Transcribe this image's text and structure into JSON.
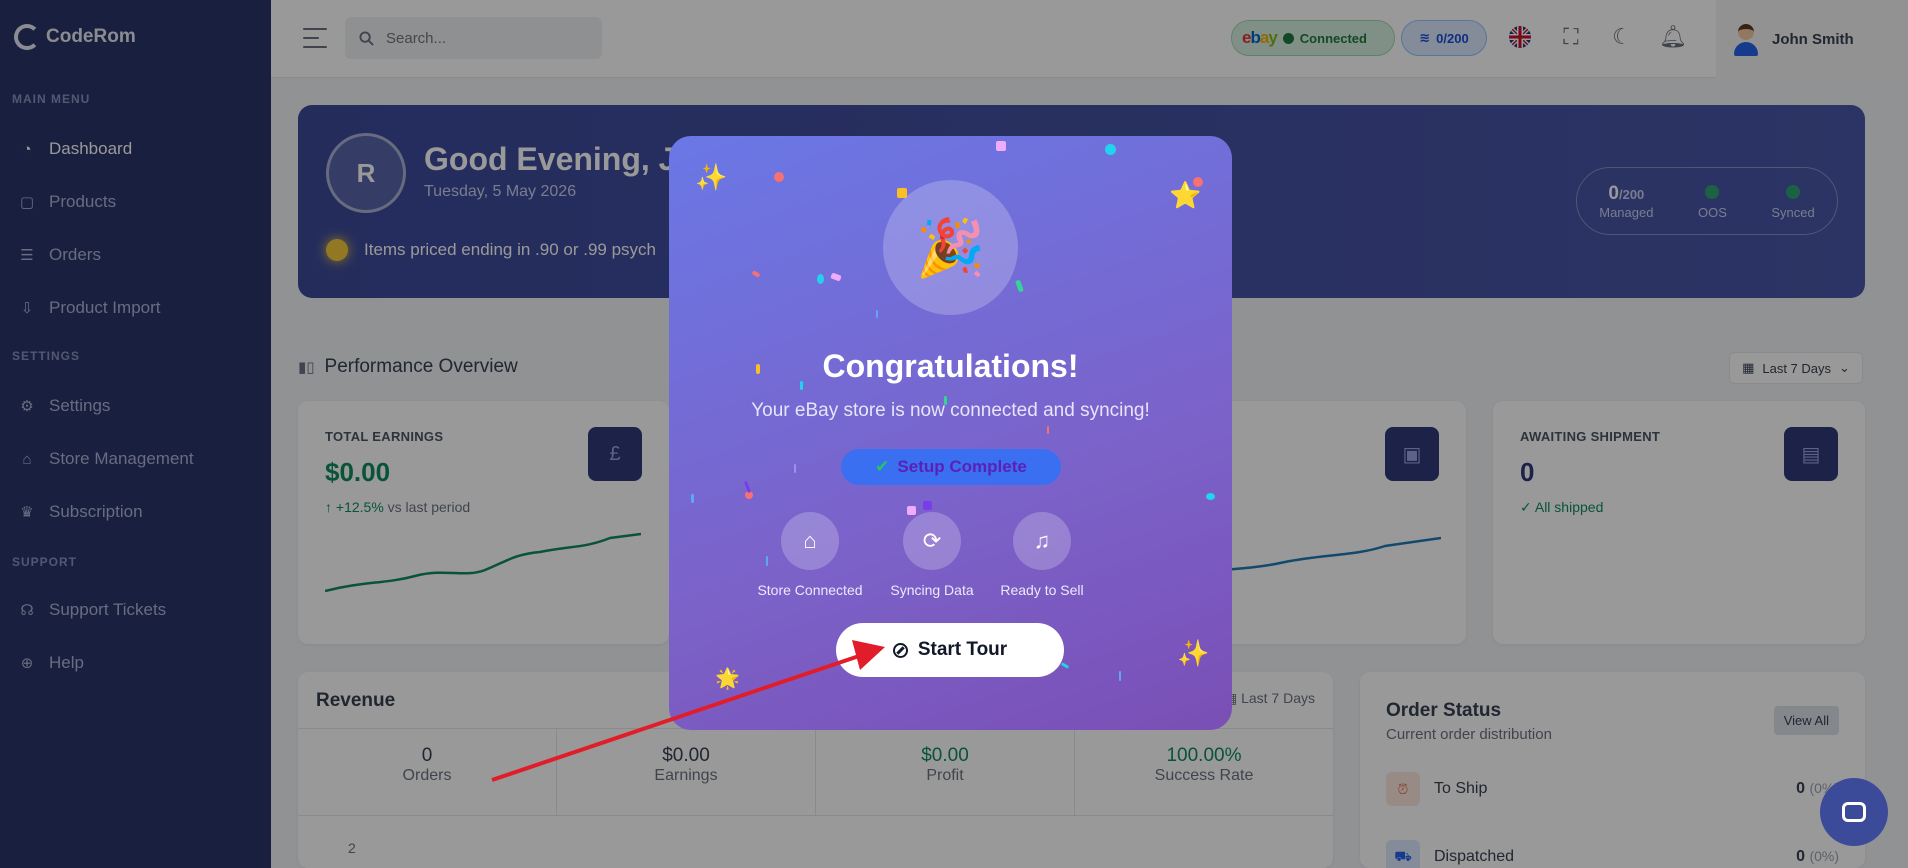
{
  "sidebar": {
    "logo": "CodeRom",
    "sections": {
      "main": "MAIN MENU",
      "settings": "SETTINGS",
      "support": "SUPPORT"
    },
    "items": {
      "dashboard": "Dashboard",
      "products": "Products",
      "orders": "Orders",
      "product_import": "Product Import",
      "settings": "Settings",
      "store_management": "Store Management",
      "subscription": "Subscription",
      "support_tickets": "Support Tickets",
      "help": "Help"
    }
  },
  "header": {
    "search_placeholder": "Search...",
    "ebay_status": "Connected",
    "ebay_logo": {
      "e": "e",
      "b": "b",
      "a": "a",
      "y": "y"
    },
    "listing_count": "0/200",
    "user_name": "John Smith"
  },
  "hero": {
    "avatar_initial": "R",
    "greeting": "Good Evening, Jo",
    "date": "Tuesday, 5 May 2026",
    "tip": "Items priced ending in .90 or .99 psych",
    "stats": {
      "managed_value": "0",
      "managed_total": "/200",
      "managed_label": "Managed",
      "oos_label": "OOS",
      "synced_label": "Synced"
    }
  },
  "performance": {
    "title": "Performance Overview",
    "range": "Last 7 Days"
  },
  "cards": {
    "earnings": {
      "label": "TOTAL EARNINGS",
      "value": "$0.00",
      "change": "+12.5%",
      "change_suffix": "vs last period"
    },
    "awaiting": {
      "label": "AWAITING SHIPMENT",
      "value": "0",
      "status": "All shipped"
    }
  },
  "revenue": {
    "title": "Revenue",
    "range": "Last 7 Days",
    "stats": [
      {
        "value": "0",
        "label": "Orders"
      },
      {
        "value": "$0.00",
        "label": "Earnings"
      },
      {
        "value": "$0.00",
        "label": "Profit"
      },
      {
        "value": "100.00%",
        "label": "Success Rate"
      }
    ],
    "axis_tick": "2"
  },
  "order_status": {
    "title": "Order Status",
    "subtitle": "Current order distribution",
    "view_all": "View All",
    "rows": [
      {
        "label": "To Ship",
        "value": "0",
        "pct": "(0%)"
      },
      {
        "label": "Dispatched",
        "value": "0",
        "pct": "(0%)"
      }
    ]
  },
  "modal": {
    "title": "Congratulations!",
    "subtitle": "Your eBay store is now connected and syncing!",
    "pill": "Setup Complete",
    "steps": [
      "Store Connected",
      "Syncing Data",
      "Ready to Sell"
    ],
    "button": "Start Tour"
  },
  "colors": {
    "sidebar": "#2a3469",
    "accent": "#3c4a9a",
    "success": "#0f8a5f",
    "annotation_arrow": "#e11d2a"
  }
}
